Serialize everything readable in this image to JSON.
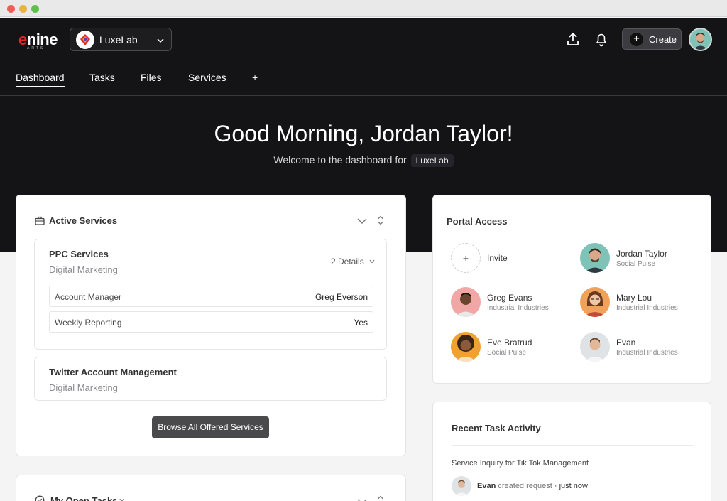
{
  "app": {
    "logo_text_e": "e",
    "logo_text_rest": "nine",
    "logo_sub": "ARTS",
    "workspace_name": "LuxeLab"
  },
  "header": {
    "create_label": "Create",
    "icons": [
      "upload-icon",
      "bell-icon",
      "plus-icon",
      "chevron-down-icon"
    ]
  },
  "tabs": [
    {
      "label": "Dashboard",
      "active": true
    },
    {
      "label": "Tasks",
      "active": false
    },
    {
      "label": "Files",
      "active": false
    },
    {
      "label": "Services",
      "active": false
    },
    {
      "label": "+",
      "active": false
    }
  ],
  "hero": {
    "greeting": "Good Morning, Jordan Taylor!",
    "welcome_prefix": "Welcome to the dashboard for",
    "workspace_pill": "LuxeLab"
  },
  "active_services": {
    "title": "Active Services",
    "services": [
      {
        "name": "PPC Services",
        "category": "Digital Marketing",
        "details_toggle": "2 Details",
        "details": [
          {
            "key": "Account Manager",
            "value": "Greg Everson"
          },
          {
            "key": "Weekly Reporting",
            "value": "Yes"
          }
        ]
      },
      {
        "name": "Twitter Account Management",
        "category": "Digital Marketing"
      }
    ],
    "browse_label": "Browse All Offered Services"
  },
  "open_tasks": {
    "title": "My Open Tasks"
  },
  "portal_access": {
    "title": "Portal Access",
    "invite_label": "Invite",
    "invite_symbol": "+",
    "people": [
      {
        "name": "Jordan Taylor",
        "company": "Social Pulse"
      },
      {
        "name": "Greg Evans",
        "company": "Industrial Industries"
      },
      {
        "name": "Mary Lou",
        "company": "Industrial Industries"
      },
      {
        "name": "Eve Bratrud",
        "company": "Social Pulse"
      },
      {
        "name": "Evan",
        "company": "Industrial Industries"
      }
    ]
  },
  "recent_activity": {
    "title": "Recent Task Activity",
    "items": [
      {
        "task": "Service Inquiry for Tik Tok Management",
        "actor": "Evan",
        "action": "created request",
        "separator": "·",
        "time": "just now"
      }
    ]
  },
  "colors": {
    "header_bg": "#141416",
    "brand_red": "#e2262b",
    "button_dark": "#4a4a4d"
  }
}
